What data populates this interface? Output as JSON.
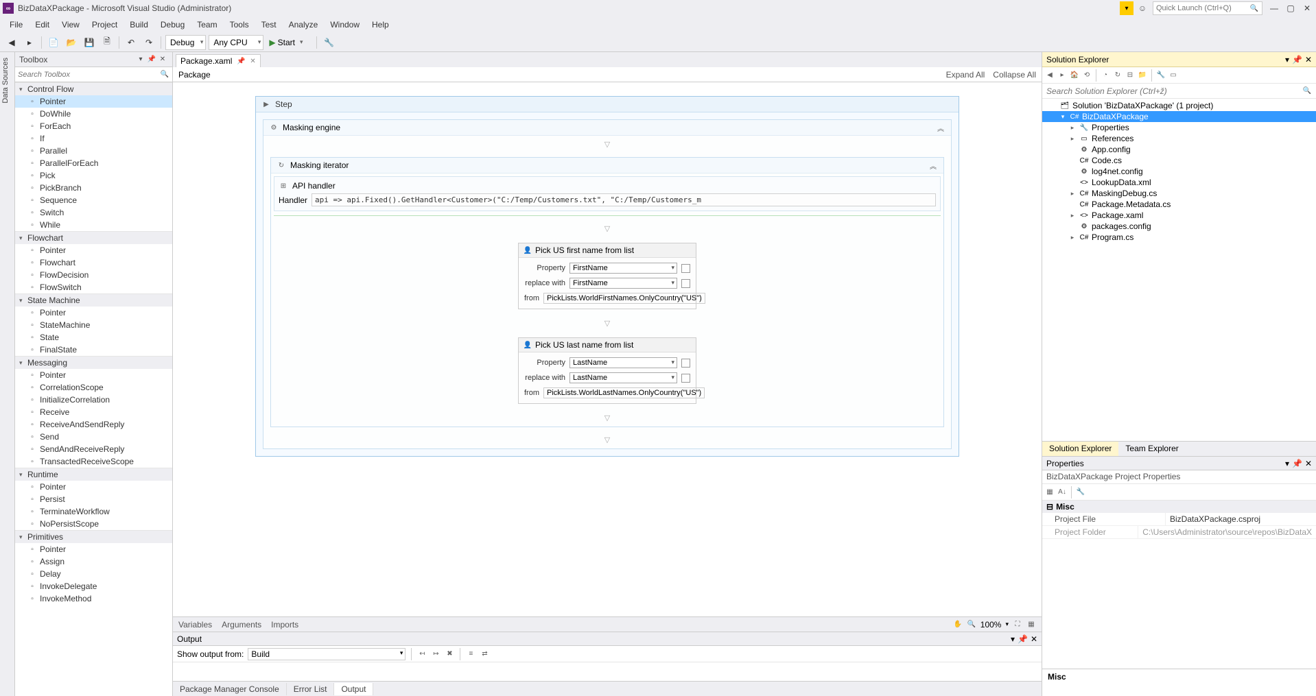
{
  "title": "BizDataXPackage - Microsoft Visual Studio  (Administrator)",
  "quicklaunch_placeholder": "Quick Launch (Ctrl+Q)",
  "menus": [
    "File",
    "Edit",
    "View",
    "Project",
    "Build",
    "Debug",
    "Team",
    "Tools",
    "Test",
    "Analyze",
    "Window",
    "Help"
  ],
  "toolbar": {
    "config": "Debug",
    "platform": "Any CPU",
    "start": "Start"
  },
  "sidetab": "Data Sources",
  "toolbox": {
    "title": "Toolbox",
    "search_placeholder": "Search Toolbox",
    "groups": [
      {
        "name": "Control Flow",
        "items": [
          "Pointer",
          "DoWhile",
          "ForEach<T>",
          "If",
          "Parallel",
          "ParallelForEach<T>",
          "Pick",
          "PickBranch",
          "Sequence",
          "Switch<T>",
          "While"
        ],
        "selected": 0
      },
      {
        "name": "Flowchart",
        "items": [
          "Pointer",
          "Flowchart",
          "FlowDecision",
          "FlowSwitch<T>"
        ]
      },
      {
        "name": "State Machine",
        "items": [
          "Pointer",
          "StateMachine",
          "State",
          "FinalState"
        ]
      },
      {
        "name": "Messaging",
        "items": [
          "Pointer",
          "CorrelationScope",
          "InitializeCorrelation",
          "Receive",
          "ReceiveAndSendReply",
          "Send",
          "SendAndReceiveReply",
          "TransactedReceiveScope"
        ]
      },
      {
        "name": "Runtime",
        "items": [
          "Pointer",
          "Persist",
          "TerminateWorkflow",
          "NoPersistScope"
        ]
      },
      {
        "name": "Primitives",
        "items": [
          "Pointer",
          "Assign",
          "Delay",
          "InvokeDelegate",
          "InvokeMethod"
        ]
      }
    ]
  },
  "editor": {
    "tab": "Package.xaml",
    "breadcrumb": "Package",
    "expand": "Expand All",
    "collapse": "Collapse All",
    "step_label": "Step",
    "masking_engine": "Masking engine",
    "masking_iterator": "Masking iterator",
    "api_handler": "API handler",
    "handler_label": "Handler",
    "handler_value": "api => api.Fixed().GetHandler<Customer>(\"C:/Temp/Customers.txt\", \"C:/Temp/Customers_m",
    "pick_first": {
      "title": "Pick US first name from list",
      "property_label": "Property",
      "property_value": "FirstName",
      "replace_label": "replace with",
      "replace_value": "FirstName",
      "from_label": "from",
      "from_value": "PickLists.WorldFirstNames.OnlyCountry(\"US\")"
    },
    "pick_last": {
      "title": "Pick US last name from list",
      "property_label": "Property",
      "property_value": "LastName",
      "replace_label": "replace with",
      "replace_value": "LastName",
      "from_label": "from",
      "from_value": "PickLists.WorldLastNames.OnlyCountry(\"US\")"
    },
    "bottom_tabs": [
      "Variables",
      "Arguments",
      "Imports"
    ],
    "zoom": "100%"
  },
  "output": {
    "title": "Output",
    "show_from_label": "Show output from:",
    "show_from_value": "Build"
  },
  "bottom_tabs": {
    "pmc": "Package Manager Console",
    "errlist": "Error List",
    "output": "Output"
  },
  "solution_explorer": {
    "title": "Solution Explorer",
    "search_placeholder": "Search Solution Explorer (Ctrl+ž)",
    "solution": "Solution 'BizDataXPackage' (1 project)",
    "project": "BizDataXPackage",
    "nodes": [
      "Properties",
      "References",
      "App.config",
      "Code.cs",
      "log4net.config",
      "LookupData.xml",
      "MaskingDebug.cs",
      "Package.Metadata.cs",
      "Package.xaml",
      "packages.config",
      "Program.cs"
    ],
    "tabs": {
      "se": "Solution Explorer",
      "te": "Team Explorer"
    }
  },
  "properties": {
    "title": "Properties",
    "subtitle": "BizDataXPackage Project Properties",
    "misc": "Misc",
    "rows": [
      {
        "k": "Project File",
        "v": "BizDataXPackage.csproj",
        "ro": false
      },
      {
        "k": "Project Folder",
        "v": "C:\\Users\\Administrator\\source\\repos\\BizDataX",
        "ro": true
      }
    ],
    "desc_key": "Misc"
  }
}
